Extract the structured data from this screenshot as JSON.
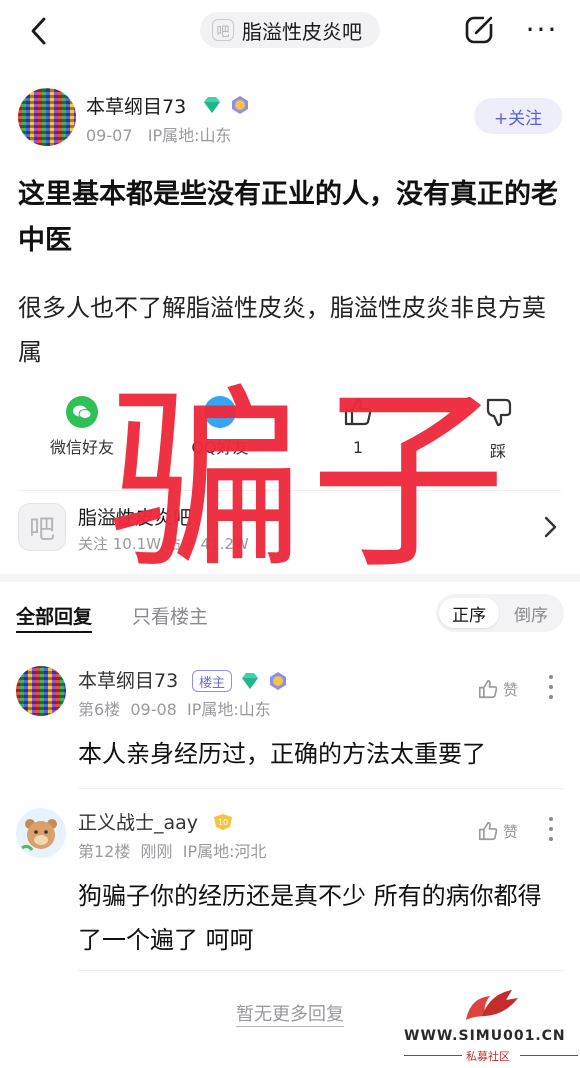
{
  "header": {
    "forum_badge": "吧",
    "forum_name": "脂溢性皮炎吧"
  },
  "post": {
    "author": "本草纲目73",
    "date": "09-07",
    "ip": "IP属地:山东",
    "follow_label": "+关注",
    "title": "这里基本都是些没有正业的人，没有真正的老中医",
    "body": "很多人也不了解脂溢性皮炎，脂溢性皮炎非良方莫属"
  },
  "actions": {
    "wechat": "微信好友",
    "qq": "QQ好友",
    "like_count": "1",
    "dislike": "踩"
  },
  "overlay": "骗子",
  "forum_card": {
    "logo": "吧",
    "name": "脂溢性皮炎吧",
    "stats": "关注 10.1W  帖子 41.2W"
  },
  "reply_tabs": {
    "all": "全部回复",
    "op_only": "只看楼主",
    "sort_asc": "正序",
    "sort_desc": "倒序"
  },
  "replies": [
    {
      "author": "本草纲目73",
      "badge": "楼主",
      "floor": "第6楼",
      "date": "09-08",
      "ip": "IP属地:山东",
      "like_label": "赞",
      "text": "本人亲身经历过，正确的方法太重要了"
    },
    {
      "author": "正义战士_aay",
      "level": "10",
      "floor": "第12楼",
      "date": "刚刚",
      "ip": "IP属地:河北",
      "like_label": "赞",
      "text": "狗骗子你的经历还是真不少 所有的病你都得了一个遍了 呵呵"
    }
  ],
  "footer": {
    "no_more": "暂无更多回复"
  },
  "watermark": {
    "url": "WWW.SIMU001.CN",
    "sub": "私募社区"
  },
  "colors": {
    "accent": "#5b5fd6",
    "overlay_red": "#ee2a3c",
    "wechat_green": "#2dc156"
  }
}
